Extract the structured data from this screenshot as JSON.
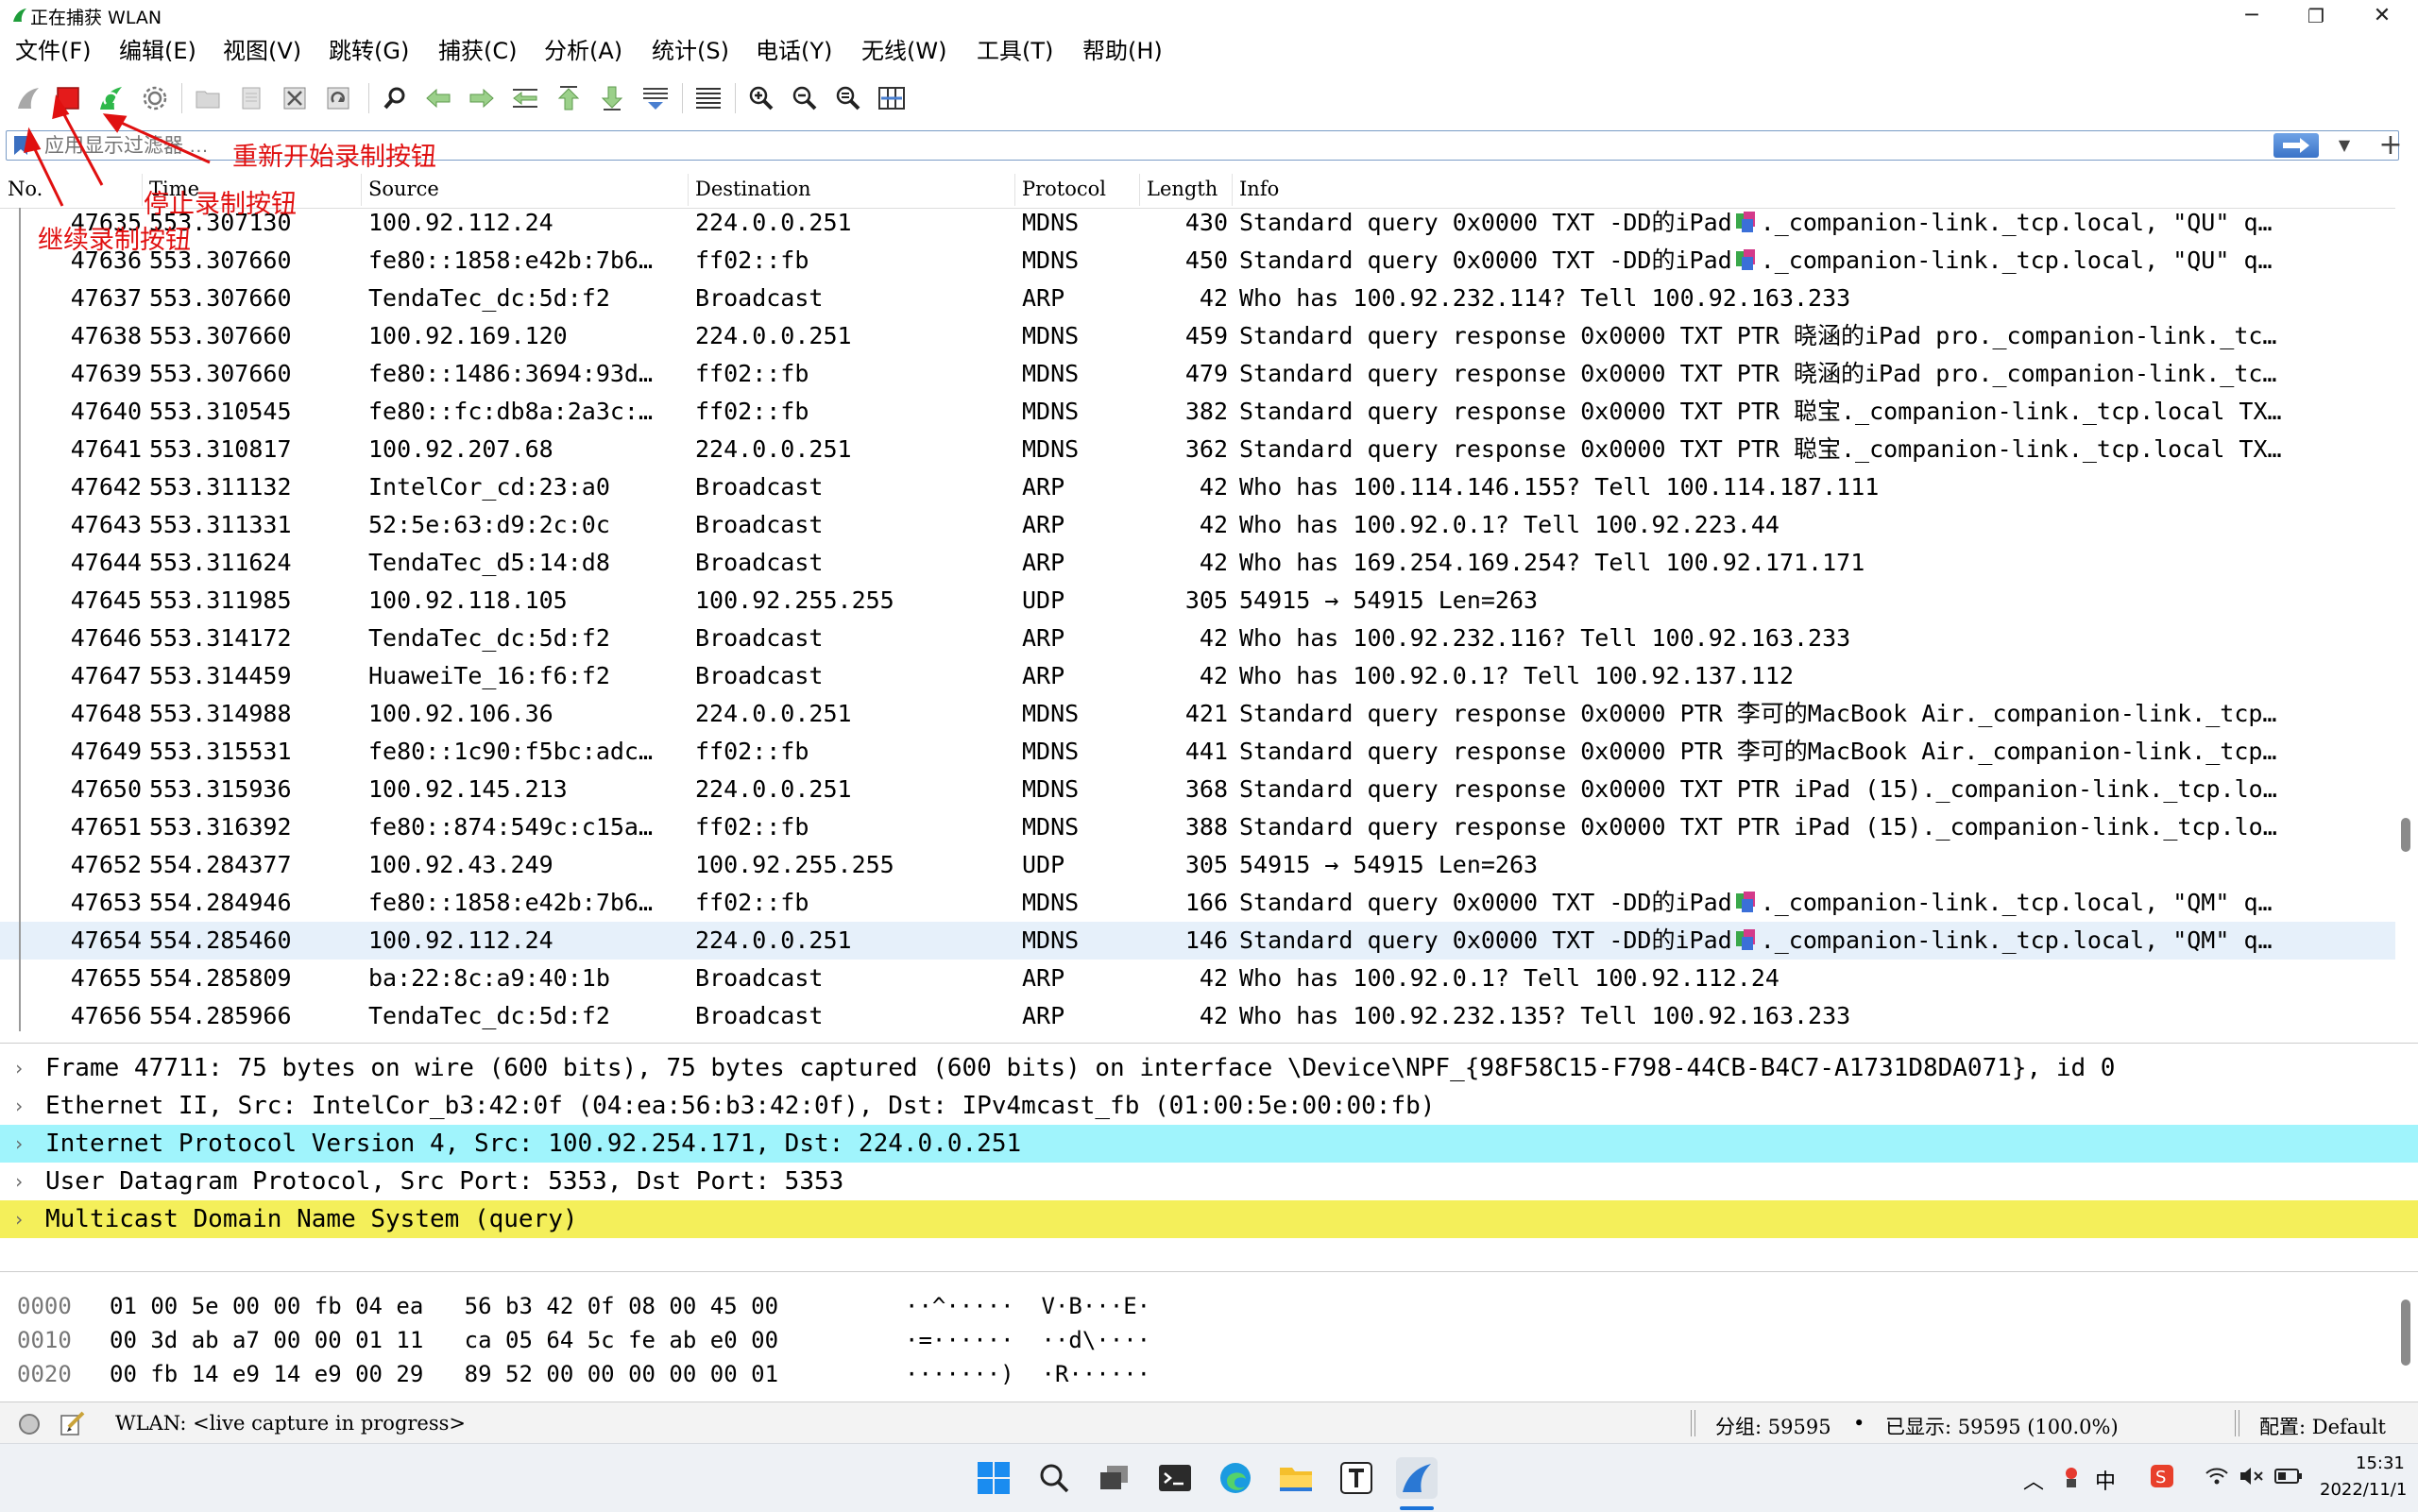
{
  "window": {
    "title": "正在捕获 WLAN",
    "minimize": "─",
    "maximize": "❐",
    "close": "✕"
  },
  "menu": [
    "文件(F)",
    "编辑(E)",
    "视图(V)",
    "跳转(G)",
    "捕获(C)",
    "分析(A)",
    "统计(S)",
    "电话(Y)",
    "无线(W)",
    "工具(T)",
    "帮助(H)"
  ],
  "filter": {
    "placeholder": "应用显示过滤器 …",
    "apply_icon": "arrow-right-icon",
    "add": "+"
  },
  "columns": [
    "No.",
    "Time",
    "Source",
    "Destination",
    "Protocol",
    "Length",
    "Info"
  ],
  "packets": [
    {
      "no": "47635",
      "time": "553.307130",
      "src": "100.92.112.24",
      "dst": "224.0.0.251",
      "proto": "MDNS",
      "len": "430",
      "info": "Standard query 0x0000 TXT -DD的iPad",
      "info2": "._companion-link._tcp.local, \"QU\" q…",
      "glyph": true
    },
    {
      "no": "47636",
      "time": "553.307660",
      "src": "fe80::1858:e42b:7b6…",
      "dst": "ff02::fb",
      "proto": "MDNS",
      "len": "450",
      "info": "Standard query 0x0000 TXT -DD的iPad",
      "info2": "._companion-link._tcp.local, \"QU\" q…",
      "glyph": true
    },
    {
      "no": "47637",
      "time": "553.307660",
      "src": "TendaTec_dc:5d:f2",
      "dst": "Broadcast",
      "proto": "ARP",
      "len": "42",
      "info": "Who has 100.92.232.114? Tell 100.92.163.233"
    },
    {
      "no": "47638",
      "time": "553.307660",
      "src": "100.92.169.120",
      "dst": "224.0.0.251",
      "proto": "MDNS",
      "len": "459",
      "info": "Standard query response 0x0000 TXT PTR 晓涵的iPad pro._companion-link._tc…"
    },
    {
      "no": "47639",
      "time": "553.307660",
      "src": "fe80::1486:3694:93d…",
      "dst": "ff02::fb",
      "proto": "MDNS",
      "len": "479",
      "info": "Standard query response 0x0000 TXT PTR 晓涵的iPad pro._companion-link._tc…"
    },
    {
      "no": "47640",
      "time": "553.310545",
      "src": "fe80::fc:db8a:2a3c:…",
      "dst": "ff02::fb",
      "proto": "MDNS",
      "len": "382",
      "info": "Standard query response 0x0000 TXT PTR 聪宝._companion-link._tcp.local TX…"
    },
    {
      "no": "47641",
      "time": "553.310817",
      "src": "100.92.207.68",
      "dst": "224.0.0.251",
      "proto": "MDNS",
      "len": "362",
      "info": "Standard query response 0x0000 TXT PTR 聪宝._companion-link._tcp.local TX…"
    },
    {
      "no": "47642",
      "time": "553.311132",
      "src": "IntelCor_cd:23:a0",
      "dst": "Broadcast",
      "proto": "ARP",
      "len": "42",
      "info": "Who has 100.114.146.155? Tell 100.114.187.111"
    },
    {
      "no": "47643",
      "time": "553.311331",
      "src": "52:5e:63:d9:2c:0c",
      "dst": "Broadcast",
      "proto": "ARP",
      "len": "42",
      "info": "Who has 100.92.0.1? Tell 100.92.223.44"
    },
    {
      "no": "47644",
      "time": "553.311624",
      "src": "TendaTec_d5:14:d8",
      "dst": "Broadcast",
      "proto": "ARP",
      "len": "42",
      "info": "Who has 169.254.169.254? Tell 100.92.171.171"
    },
    {
      "no": "47645",
      "time": "553.311985",
      "src": "100.92.118.105",
      "dst": "100.92.255.255",
      "proto": "UDP",
      "len": "305",
      "info": "54915 → 54915 Len=263"
    },
    {
      "no": "47646",
      "time": "553.314172",
      "src": "TendaTec_dc:5d:f2",
      "dst": "Broadcast",
      "proto": "ARP",
      "len": "42",
      "info": "Who has 100.92.232.116? Tell 100.92.163.233"
    },
    {
      "no": "47647",
      "time": "553.314459",
      "src": "HuaweiTe_16:f6:f2",
      "dst": "Broadcast",
      "proto": "ARP",
      "len": "42",
      "info": "Who has 100.92.0.1? Tell 100.92.137.112"
    },
    {
      "no": "47648",
      "time": "553.314988",
      "src": "100.92.106.36",
      "dst": "224.0.0.251",
      "proto": "MDNS",
      "len": "421",
      "info": "Standard query response 0x0000 PTR 李可的MacBook Air._companion-link._tcp…"
    },
    {
      "no": "47649",
      "time": "553.315531",
      "src": "fe80::1c90:f5bc:adc…",
      "dst": "ff02::fb",
      "proto": "MDNS",
      "len": "441",
      "info": "Standard query response 0x0000 PTR 李可的MacBook Air._companion-link._tcp…"
    },
    {
      "no": "47650",
      "time": "553.315936",
      "src": "100.92.145.213",
      "dst": "224.0.0.251",
      "proto": "MDNS",
      "len": "368",
      "info": "Standard query response 0x0000 TXT PTR iPad (15)._companion-link._tcp.lo…"
    },
    {
      "no": "47651",
      "time": "553.316392",
      "src": "fe80::874:549c:c15a…",
      "dst": "ff02::fb",
      "proto": "MDNS",
      "len": "388",
      "info": "Standard query response 0x0000 TXT PTR iPad (15)._companion-link._tcp.lo…"
    },
    {
      "no": "47652",
      "time": "554.284377",
      "src": "100.92.43.249",
      "dst": "100.92.255.255",
      "proto": "UDP",
      "len": "305",
      "info": "54915 → 54915 Len=263"
    },
    {
      "no": "47653",
      "time": "554.284946",
      "src": "fe80::1858:e42b:7b6…",
      "dst": "ff02::fb",
      "proto": "MDNS",
      "len": "166",
      "info": "Standard query 0x0000 TXT -DD的iPad",
      "info2": "._companion-link._tcp.local, \"QM\" q…",
      "glyph": true
    },
    {
      "no": "47654",
      "time": "554.285460",
      "src": "100.92.112.24",
      "dst": "224.0.0.251",
      "proto": "MDNS",
      "len": "146",
      "info": "Standard query 0x0000 TXT -DD的iPad",
      "info2": "._companion-link._tcp.local, \"QM\" q…",
      "glyph": true,
      "selected": true
    },
    {
      "no": "47655",
      "time": "554.285809",
      "src": "ba:22:8c:a9:40:1b",
      "dst": "Broadcast",
      "proto": "ARP",
      "len": "42",
      "info": "Who has 100.92.0.1? Tell 100.92.112.24"
    },
    {
      "no": "47656",
      "time": "554.285966",
      "src": "TendaTec_dc:5d:f2",
      "dst": "Broadcast",
      "proto": "ARP",
      "len": "42",
      "info": "Who has 100.92.232.135? Tell 100.92.163.233"
    }
  ],
  "details": [
    {
      "text": "Frame 47711: 75 bytes on wire (600 bits), 75 bytes captured (600 bits) on interface \\Device\\NPF_{98F58C15-F798-44CB-B4C7-A1731D8DA071}, id 0",
      "bg": "#ffffff"
    },
    {
      "text": "Ethernet II, Src: IntelCor_b3:42:0f (04:ea:56:b3:42:0f), Dst: IPv4mcast_fb (01:00:5e:00:00:fb)",
      "bg": "#ffffff"
    },
    {
      "text": "Internet Protocol Version 4, Src: 100.92.254.171, Dst: 224.0.0.251",
      "bg": "#a0f4fc"
    },
    {
      "text": "User Datagram Protocol, Src Port: 5353, Dst Port: 5353",
      "bg": "#ffffff"
    },
    {
      "text": "Multicast Domain Name System (query)",
      "bg": "#f4ef5a"
    }
  ],
  "bytes": [
    {
      "offset": "0000",
      "hex": "01 00 5e 00 00 fb 04 ea   56 b3 42 0f 08 00 45 00",
      "ascii": "··^·····  V·B···E·"
    },
    {
      "offset": "0010",
      "hex": "00 3d ab a7 00 00 01 11   ca 05 64 5c fe ab e0 00",
      "ascii": "·=······  ··d\\····"
    },
    {
      "offset": "0020",
      "hex": "00 fb 14 e9 14 e9 00 29   89 52 00 00 00 00 00 01",
      "ascii": "·······)  ·R······"
    }
  ],
  "status": {
    "capture": "WLAN: <live capture in progress>",
    "packets": "分组: 59595",
    "displayed": "已显示: 59595 (100.0%)",
    "profile": "配置: Default"
  },
  "annotations": {
    "restart": "重新开始录制按钮",
    "stop": "停止录制按钮",
    "resume": "继续录制按钮"
  },
  "taskbar": {
    "time": "15:31",
    "date": "2022/11/1",
    "ime": "中"
  },
  "colors": {
    "selected_row": "#e6f0fa",
    "ip_highlight": "#a0f4fc",
    "dns_highlight": "#f4ef5a",
    "annotation": "#e01010"
  }
}
